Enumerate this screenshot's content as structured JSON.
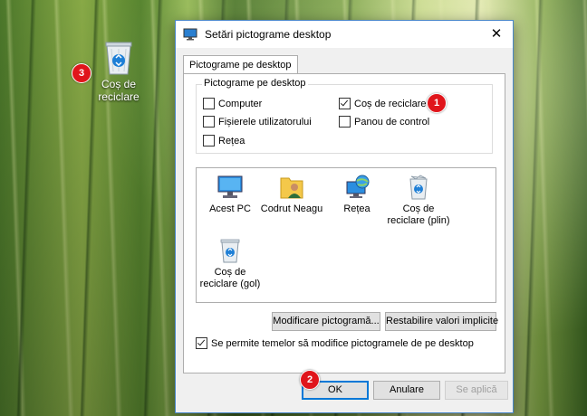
{
  "desktop": {
    "recycle_bin_label": "Coș de\nreciclare",
    "recycle_bin_line1": "Coș de",
    "recycle_bin_line2": "reciclare"
  },
  "badges": [
    "1",
    "2",
    "3"
  ],
  "dialog": {
    "title": "Setări pictograme desktop",
    "close_glyph": "✕",
    "tab_label": "Pictograme pe desktop",
    "group_title": "Pictograme pe desktop",
    "checkboxes": [
      {
        "label": "Computer",
        "checked": false
      },
      {
        "label": "Coș de reciclare",
        "checked": true
      },
      {
        "label": "Fișierele utilizatorului",
        "checked": false
      },
      {
        "label": "Panou de control",
        "checked": false
      },
      {
        "label": "Rețea",
        "checked": false
      }
    ],
    "icons": [
      {
        "label_line1": "Acest PC",
        "label_line2": "",
        "icon": "computer-icon"
      },
      {
        "label_line1": "Codrut Neagu",
        "label_line2": "",
        "icon": "user-folder-icon"
      },
      {
        "label_line1": "Rețea",
        "label_line2": "",
        "icon": "network-icon"
      },
      {
        "label_line1": "Coș de",
        "label_line2": "reciclare (plin)",
        "icon": "recycle-bin-full-icon"
      },
      {
        "label_line1": "Coș de",
        "label_line2": "reciclare (gol)",
        "icon": "recycle-bin-empty-icon"
      }
    ],
    "change_icon_button": "Modificare pictogramă...",
    "restore_default_button": "Restabilire valori implicite",
    "allow_themes_label": "Se permite temelor să modifice pictogramele de pe desktop",
    "allow_themes_checked": true,
    "ok_button": "OK",
    "cancel_button": "Anulare",
    "apply_button": "Se aplică"
  },
  "colors": {
    "accent": "#0078d7",
    "badge": "#e0151b",
    "dialog_border": "#4a87c9"
  }
}
